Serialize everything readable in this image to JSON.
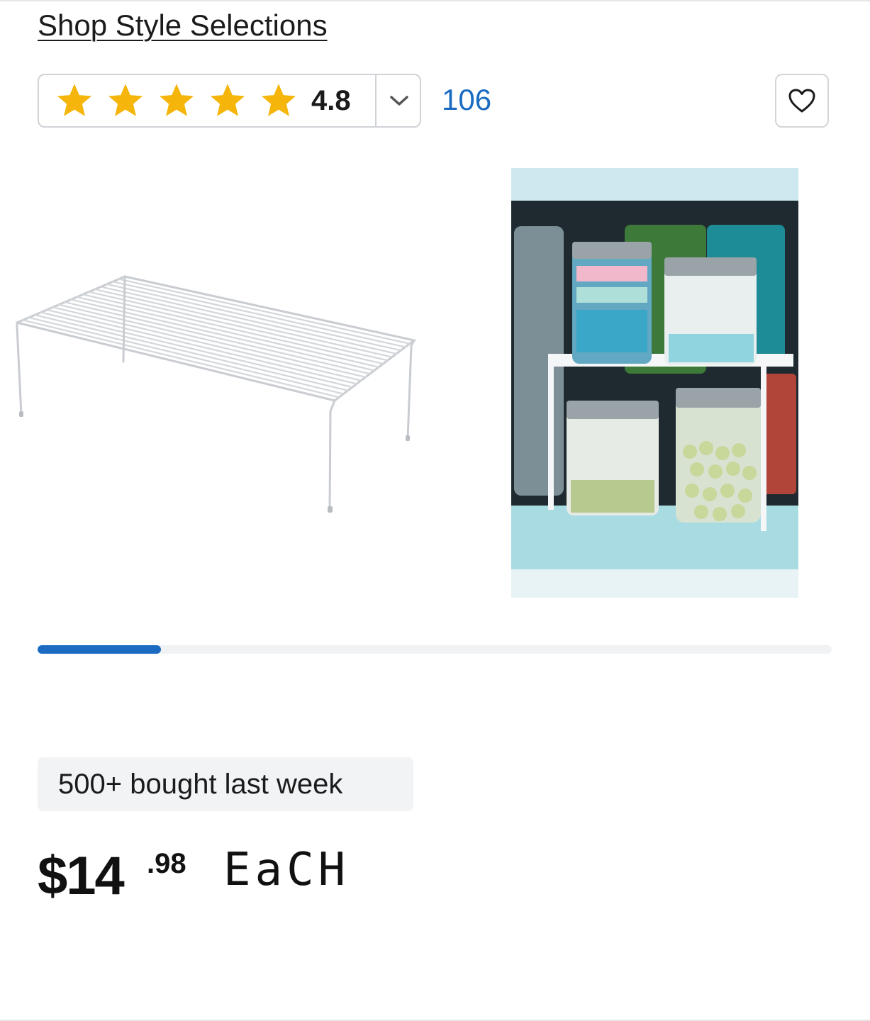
{
  "header": {
    "brand_link": "Shop Style Selections"
  },
  "rating": {
    "value": "4.8",
    "stars_filled": 5,
    "stars_total": 5,
    "review_count": "106",
    "star_color": "#f5b50a"
  },
  "favorite": {
    "icon": "heart-icon"
  },
  "gallery": {
    "images": [
      {
        "subject": "white wire cabinet shelf riser"
      },
      {
        "subject": "shelf riser in cabinet with jars"
      }
    ],
    "progress": 0.155,
    "accent_color": "#1a6bc1"
  },
  "social_proof": {
    "text": "500+ bought last week"
  },
  "price": {
    "dollars": "$14",
    "cents": ".98",
    "unit": "EaCH"
  }
}
